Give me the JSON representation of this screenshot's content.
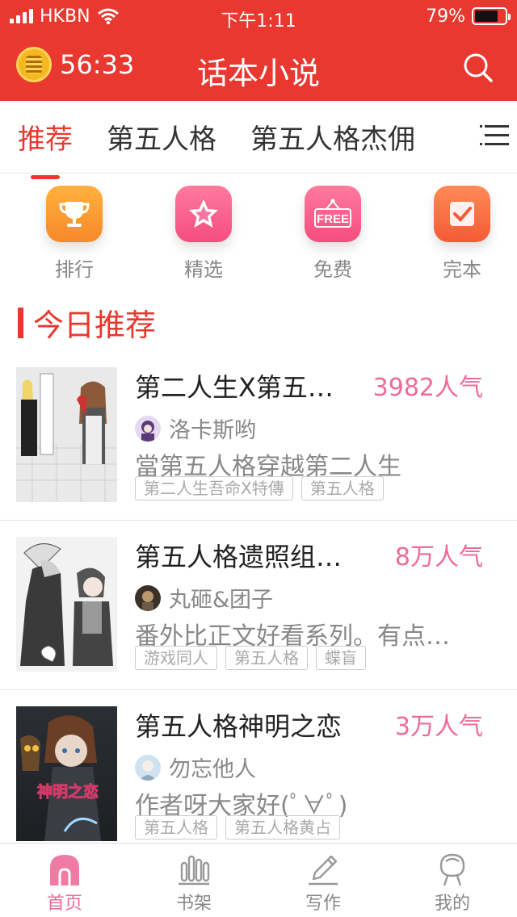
{
  "status": {
    "carrier": "HKBN",
    "time": "下午1:11",
    "battery": "79%",
    "battery_level": 0.79
  },
  "header": {
    "timer": "56:33",
    "title": "话本小说"
  },
  "tabs": [
    {
      "label": "推荐",
      "active": true
    },
    {
      "label": "第五人格",
      "active": false
    },
    {
      "label": "第五人格杰佣",
      "active": false
    }
  ],
  "categories": [
    {
      "label": "排行",
      "icon": "trophy-icon",
      "color": "#f7892b"
    },
    {
      "label": "精选",
      "icon": "star-icon",
      "color": "#f54d7e"
    },
    {
      "label": "免费",
      "icon": "free-sign-icon",
      "color": "#f54d7e",
      "badge": "FREE"
    },
    {
      "label": "完本",
      "icon": "check-icon",
      "color": "#f55a35"
    }
  ],
  "section_title": "今日推荐",
  "books": [
    {
      "title": "第二人生X第五…",
      "popularity": "3982人气",
      "author": "洛卡斯哟",
      "description": "當第五人格穿越第二人生",
      "tags": [
        "第二人生吾命X特傳",
        "第五人格"
      ]
    },
    {
      "title": "第五人格遗照组…",
      "popularity": "8万人气",
      "author": "丸砸&团子",
      "description": "番外比正文好看系列。有点…",
      "tags": [
        "游戏同人",
        "第五人格",
        "蝶盲"
      ]
    },
    {
      "title": "第五人格神明之恋",
      "popularity": "3万人气",
      "author": "勿忘他人",
      "description": "作者呀大家好(ﾟ∀ﾟ)",
      "tags": [
        "第五人格",
        "第五人格黄占"
      ],
      "cover_text": "神明之恋"
    }
  ],
  "nav": [
    {
      "label": "首页",
      "icon": "home-icon",
      "active": true
    },
    {
      "label": "书架",
      "icon": "bookshelf-icon",
      "active": false
    },
    {
      "label": "写作",
      "icon": "pen-icon",
      "active": false
    },
    {
      "label": "我的",
      "icon": "profile-icon",
      "active": false
    }
  ],
  "colors": {
    "brand": "#e8382f",
    "accent_pink": "#ef6a9a"
  }
}
